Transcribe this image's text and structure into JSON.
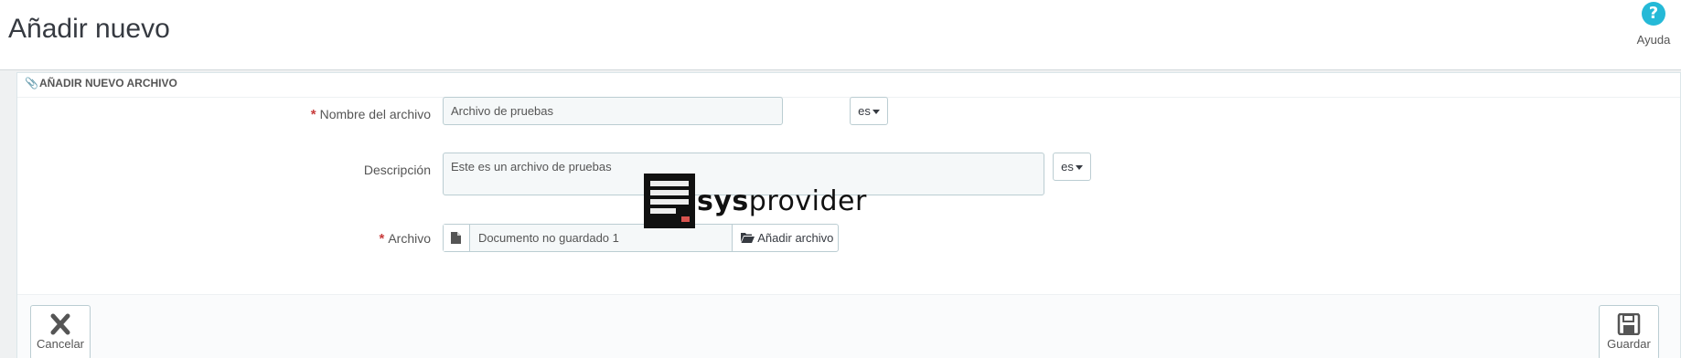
{
  "header": {
    "title": "Añadir nuevo",
    "help_label": "Ayuda",
    "help_icon": "question-circle-icon"
  },
  "panel": {
    "heading": "Añadir nuevo archivo",
    "fields": {
      "name": {
        "label": "Nombre del archivo",
        "required": true,
        "value": "Archivo de pruebas",
        "lang": "es"
      },
      "description": {
        "label": "Descripción",
        "value": "Este es un archivo de pruebas",
        "lang": "es"
      },
      "file": {
        "label": "Archivo",
        "required": true,
        "filename": "Documento no guardado 1",
        "button_label": "Añadir archivo"
      }
    }
  },
  "footer": {
    "cancel_label": "Cancelar",
    "save_label": "Guardar"
  },
  "watermark": {
    "text_bold": "sys",
    "text_regular": "provider"
  },
  "colors": {
    "accent": "#25b9d7",
    "required": "#c83c3c",
    "input_bg": "#f5f8f9",
    "border": "#bbcdd2"
  }
}
